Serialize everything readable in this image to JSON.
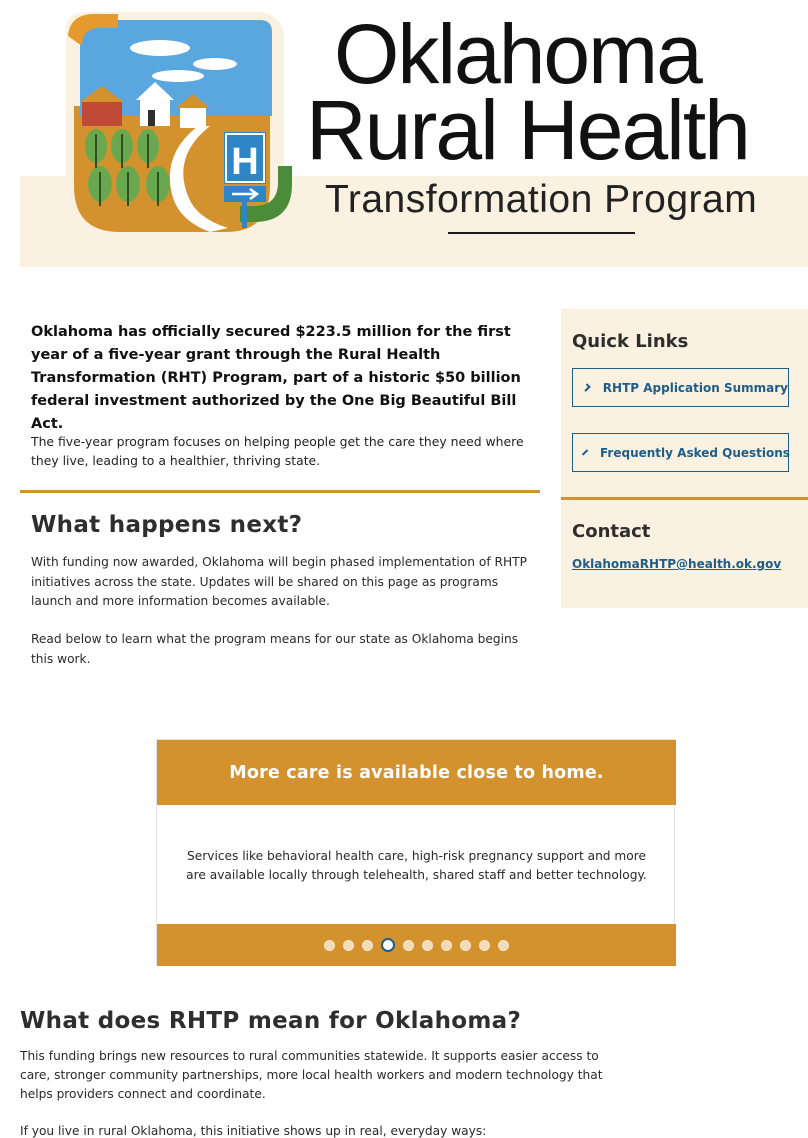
{
  "header": {
    "title_line1": "Oklahoma",
    "title_line2": "Rural Health",
    "title_line3": "Transformation Program",
    "logo_icon": "rural-hospital-logo-icon",
    "logo_sign_letter": "H"
  },
  "intro": {
    "lead": "Oklahoma has officially secured $223.5 million for the first year of a five-year grant through the Rural Health Transformation (RHT) Program, part of a historic $50 billion federal investment authorized by the One Big Beautiful Bill Act.",
    "body": "The five-year program focuses on helping people get the care they need where they live, leading to a healthier, thriving state."
  },
  "next": {
    "heading": "What happens next?",
    "p1": "With funding now awarded, Oklahoma will begin phased implementation of RHTP initiatives across the state. Updates will be shared on this page as programs launch and more information becomes available.",
    "p2": "Read below to learn what the program means for our state as Oklahoma begins this work."
  },
  "sidebar": {
    "quick_links_heading": "Quick Links",
    "links": [
      {
        "label": "RHTP Application Summary",
        "icon": "chevron-right-icon"
      },
      {
        "label": "Frequently Asked Questions",
        "icon": "chevron-right-icon"
      }
    ],
    "contact_heading": "Contact",
    "email": "OklahomaRHTP@health.ok.gov"
  },
  "carousel": {
    "title": "More care is available close to home.",
    "body": "Services like behavioral health care, high-risk pregnancy support and more are available locally through telehealth, shared staff and better technology.",
    "slide_count": 10,
    "active_slide": 4
  },
  "rhtp": {
    "heading": "What does RHTP mean for Oklahoma?",
    "p1": "This funding brings new resources to rural communities statewide. It supports easier access to care, stronger community partnerships, more local health workers and modern technology that helps providers connect and coordinate.",
    "p2": "If you live in rural Oklahoma, this initiative shows up in real, everyday ways:"
  },
  "colors": {
    "accent_orange": "#d4922f",
    "link_blue": "#1d5d8a",
    "cream": "#fbf1e1"
  }
}
